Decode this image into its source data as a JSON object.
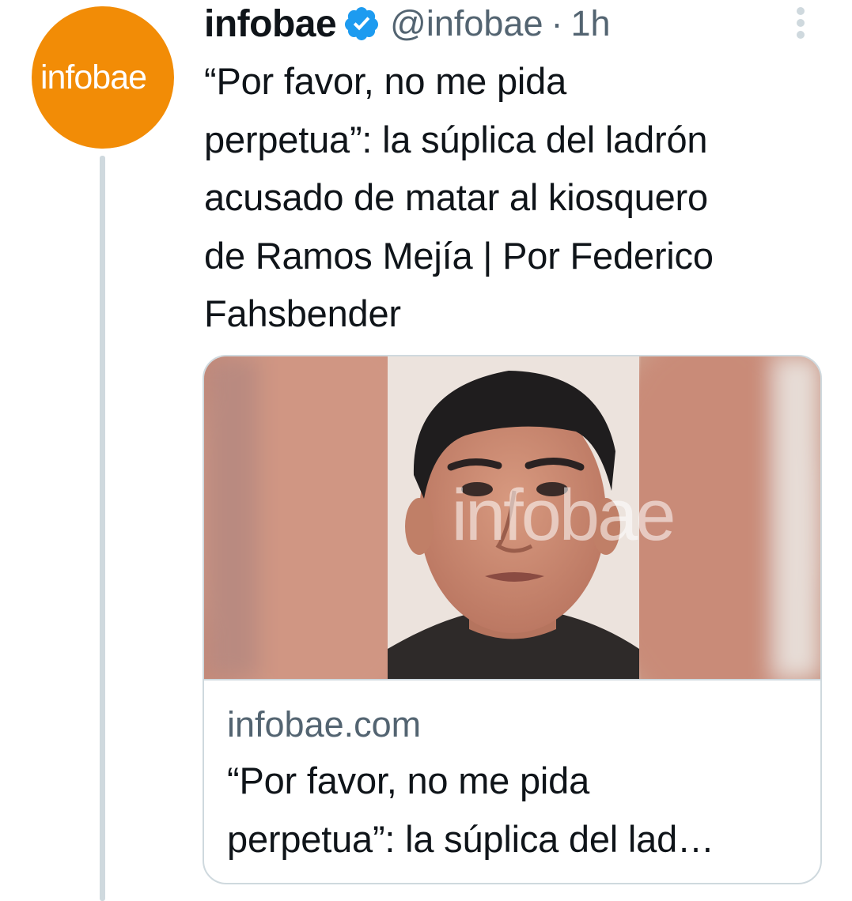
{
  "avatar": {
    "text": "infobae",
    "color": "#f28c06"
  },
  "header": {
    "display_name": "infobae",
    "handle": "@infobae",
    "separator": "·",
    "time": "1h",
    "verified_icon": "verified-badge-icon",
    "more_icon": "more-vertical-icon"
  },
  "tweet": {
    "text_lines": [
      "“Por favor, no me pida",
      "perpetua”: la súplica del ladrón",
      "acusado de matar al kiosquero",
      "de Ramos Mejía | Por Federico",
      "Fahsbender"
    ]
  },
  "card": {
    "image_watermark": "infobae",
    "domain": "infobae.com",
    "title_lines": [
      "“Por favor, no me pida",
      "perpetua”: la súplica del lad…"
    ]
  },
  "colors": {
    "accent_blue": "#1d9bf0",
    "secondary_text": "#536471",
    "border": "#cfd9de",
    "brand_orange": "#f28c06"
  }
}
